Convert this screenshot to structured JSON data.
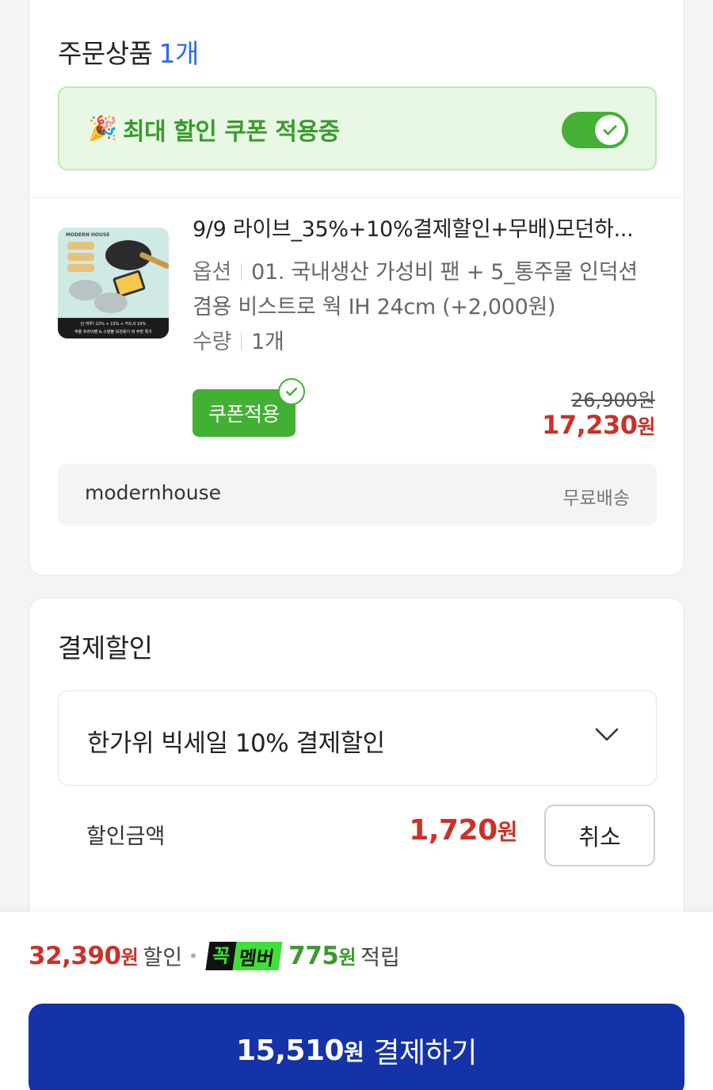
{
  "order": {
    "title": "주문상품",
    "count": "1개",
    "coupon_banner": {
      "text": "최대 할인 쿠폰 적용중",
      "toggle_on": true
    },
    "product": {
      "name": "9/9 라이브_35%+10%결제할인+무배)모던하...",
      "thumb_brand": "MODERN HOUSE",
      "thumb_band_line1": "단 하루! 22% + 13% + 카드사 10%",
      "thumb_band_line2": "주물 프라이팬 & 스텐볼 보관용기 외 주방 특가",
      "option_key": "옵션",
      "option_line1": "01. 국내생산 가성비 팬 + 5_통주물 인덕션",
      "option_line2": "겸용 비스트로 웍 IH 24cm (+2,000원)",
      "qty_key": "수량",
      "qty_value": "1개",
      "coupon_badge": "쿠폰적용",
      "old_price": "26,900원",
      "new_price": "17,230",
      "price_unit": "원"
    },
    "seller": {
      "name": "modernhouse",
      "shipping": "무료배송"
    }
  },
  "payment": {
    "title": "결제할인",
    "selected_discount": "한가위 빅세일 10% 결제할인",
    "discount_label": "할인금액",
    "discount_amount": "1,720",
    "discount_unit": "원",
    "cancel_label": "취소"
  },
  "bottom": {
    "discount_total": "32,390",
    "discount_unit": "원",
    "discount_text": "할인",
    "member_kkok": "꼭",
    "member_label": "멤버",
    "points": "775",
    "points_unit": "원",
    "points_text": "적립",
    "pay_amount": "15,510",
    "pay_unit": "원",
    "pay_label": "결제하기"
  },
  "colors": {
    "accent_blue": "#1433a8",
    "count_blue": "#2f6ae6",
    "green": "#42b033",
    "price_red": "#c8322a"
  }
}
